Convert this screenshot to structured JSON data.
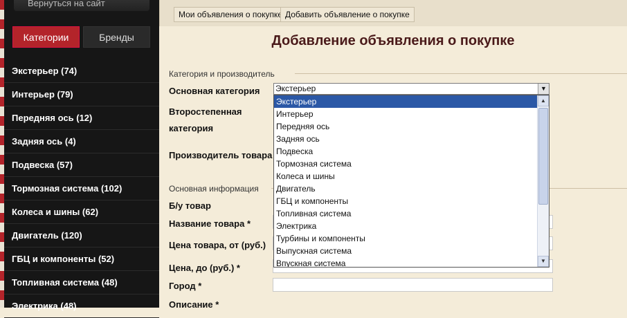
{
  "sidebar": {
    "back_label": "Вернуться на сайт",
    "tabs": {
      "categories": "Категории",
      "brands": "Бренды"
    },
    "categories": [
      "Экстерьер (74)",
      "Интерьер (79)",
      "Передняя ось (12)",
      "Задняя ось (4)",
      "Подвеска (57)",
      "Тормозная система (102)",
      "Колеса и шины (62)",
      "Двигатель (120)",
      "ГБЦ и компоненты (52)",
      "Топливная система (48)",
      "Электрика (48)"
    ]
  },
  "toolbar": {
    "my_ads": "Мои объявления о покупке",
    "add_ad": "Добавить объявление о покупке"
  },
  "page": {
    "title": "Добавление объявления о покупке"
  },
  "form": {
    "section1": "Категория и производитель",
    "main_category_label": "Основная категория",
    "main_category_value": "Экстерьер",
    "secondary_label_1": "Второстепенная",
    "secondary_label_2": "категория",
    "manufacturer_label": "Производитель товара",
    "section2": "Основная информация",
    "used_label": "Б/у товар",
    "name_label": "Название товара *",
    "price_from_label": "Цена товара, от (руб.)",
    "price_to_label": "Цена, до (руб.) *",
    "city_label": "Город *",
    "description_label": "Описание *"
  },
  "dropdown": {
    "options": [
      "Экстерьер",
      "Интерьер",
      "Передняя ось",
      "Задняя ось",
      "Подвеска",
      "Тормозная система",
      "Колеса и шины",
      "Двигатель",
      "ГБЦ и компоненты",
      "Топливная система",
      "Электрика",
      "Турбины и компоненты",
      "Выпускная система",
      "Впускная система"
    ],
    "selected_index": 0
  }
}
